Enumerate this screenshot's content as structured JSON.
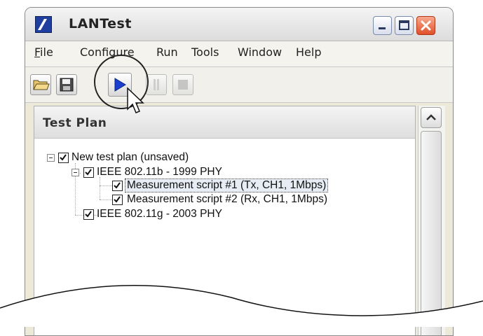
{
  "window": {
    "title": "LANTest"
  },
  "menubar": {
    "items": [
      {
        "label": "File",
        "mnemonic_index": 0
      },
      {
        "label": "Configure",
        "mnemonic_index": -1
      },
      {
        "label": "Run",
        "mnemonic_index": -1
      },
      {
        "label": "Tools",
        "mnemonic_index": -1
      },
      {
        "label": "Window",
        "mnemonic_index": -1
      },
      {
        "label": "Help",
        "mnemonic_index": -1
      }
    ]
  },
  "toolbar": {
    "buttons": [
      {
        "icon": "folder-open-icon",
        "enabled": true
      },
      {
        "icon": "save-disk-icon",
        "enabled": true
      },
      {
        "icon": "play-icon",
        "enabled": true
      },
      {
        "icon": "pause-icon",
        "enabled": false
      },
      {
        "icon": "stop-icon",
        "enabled": false
      }
    ]
  },
  "panel": {
    "title": "Test Plan"
  },
  "tree": {
    "root": {
      "label": "New test plan (unsaved)",
      "checked": true,
      "expanded": true
    },
    "plans": [
      {
        "label": "IEEE 802.11b - 1999 PHY",
        "checked": true,
        "expanded": true,
        "scripts": [
          {
            "label": "Measurement script #1 (Tx, CH1, 1Mbps)",
            "checked": true,
            "selected": true
          },
          {
            "label": "Measurement script #2 (Rx, CH1, 1Mbps)",
            "checked": true,
            "selected": false
          }
        ]
      },
      {
        "label": "IEEE 802.11g - 2003 PHY",
        "checked": true,
        "expanded": false,
        "scripts": []
      }
    ]
  },
  "colors": {
    "accent": "#1f3fa0",
    "close_button": "#e0502a",
    "play_icon": "#1a3fd0",
    "selection": "#e7ecf5"
  }
}
